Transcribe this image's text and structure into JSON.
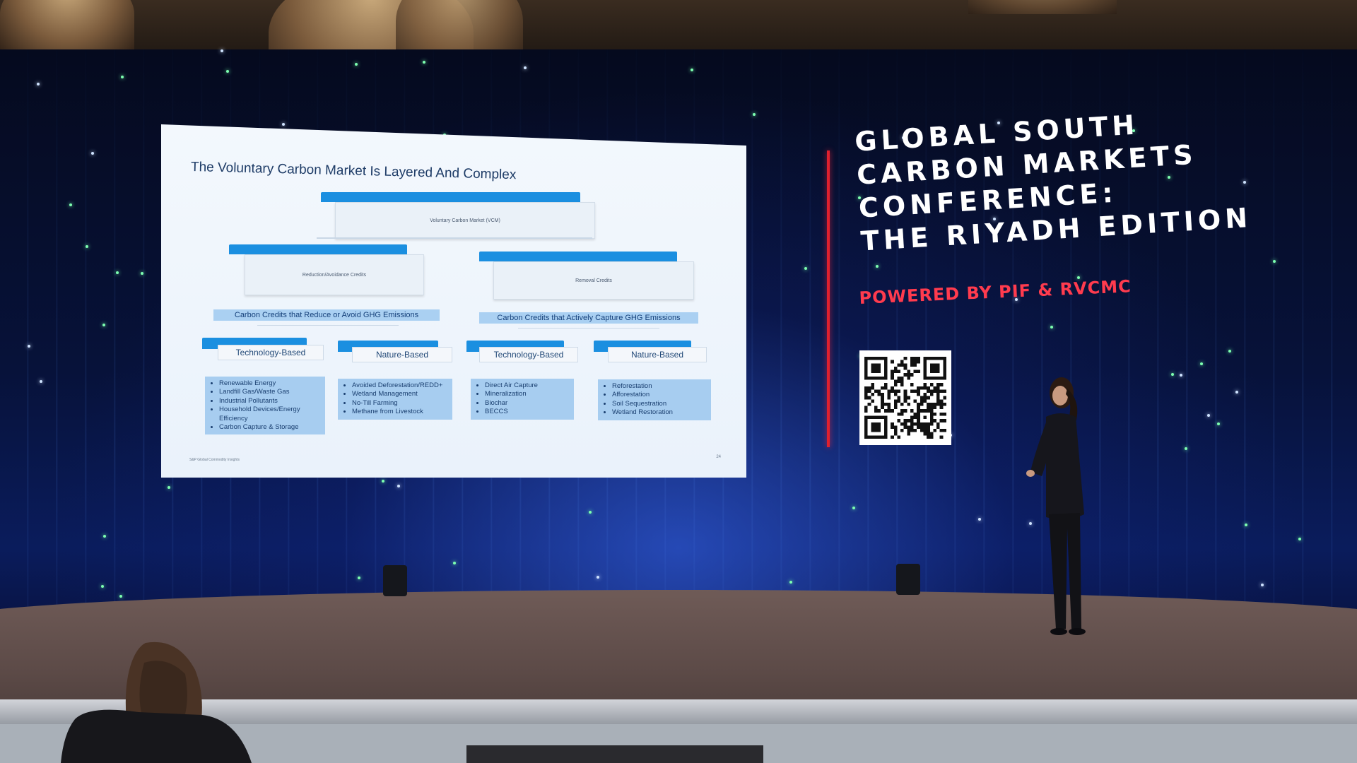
{
  "slide": {
    "title": "The Voluntary Carbon Market Is Layered And Complex",
    "top_box": "Voluntary Carbon Market (VCM)",
    "left_box": "Reduction/Avoidance Credits",
    "right_box": "Removal Credits",
    "left_band": "Carbon Credits that Reduce or Avoid GHG Emissions",
    "right_band": "Carbon Credits that Actively Capture GHG Emissions",
    "categories": [
      {
        "label": "Technology-Based",
        "items": [
          "Renewable Energy",
          "Landfill Gas/Waste Gas",
          "Industrial Pollutants",
          "Household Devices/Energy Efficiency",
          "Carbon Capture & Storage"
        ]
      },
      {
        "label": "Nature-Based",
        "items": [
          "Avoided Deforestation/REDD+",
          "Wetland Management",
          "No-Till Farming",
          "Methane from Livestock"
        ]
      },
      {
        "label": "Technology-Based",
        "items": [
          "Direct Air Capture",
          "Mineralization",
          "Biochar",
          "BECCS"
        ]
      },
      {
        "label": "Nature-Based",
        "items": [
          "Reforestation",
          "Afforestation",
          "Soil Sequestration",
          "Wetland Restoration"
        ]
      }
    ],
    "footnote": "S&P Global Commodity Insights",
    "page_number": "24"
  },
  "conference": {
    "title_lines": [
      "GLOBAL SOUTH",
      "CARBON MARKETS",
      "CONFERENCE:",
      "THE RIYADH EDITION"
    ],
    "powered_by": "POWERED BY PIF & RVCMC",
    "accent_color": "#e0202e",
    "powered_color": "#ff3b4e"
  },
  "qr": {
    "icon": "qr-code-icon"
  }
}
